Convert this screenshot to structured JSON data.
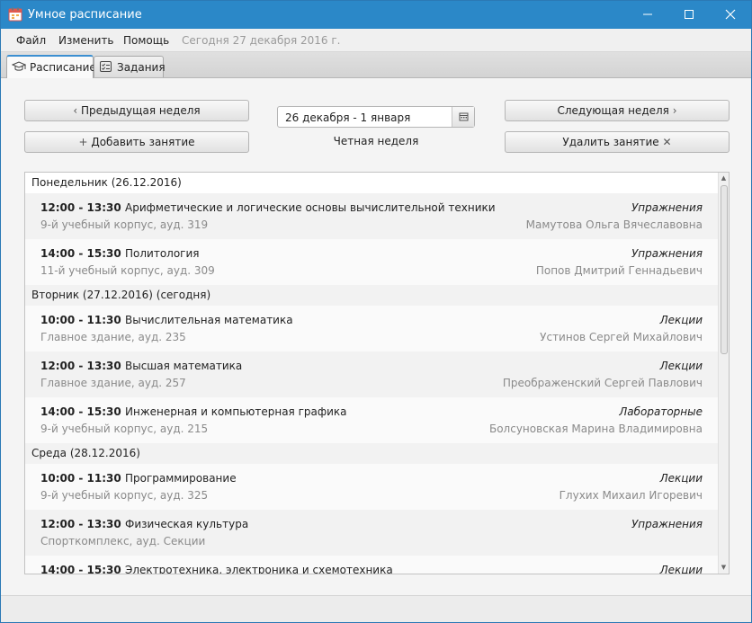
{
  "window": {
    "title": "Умное расписание"
  },
  "menu": {
    "file": "Файл",
    "edit": "Изменить",
    "help": "Помощь",
    "today": "Сегодня 27 декабря 2016 г."
  },
  "tabs": [
    {
      "label": "Расписание",
      "active": true
    },
    {
      "label": "Задания",
      "active": false
    }
  ],
  "toolbar": {
    "prev_week": "Предыдущая неделя",
    "next_week": "Следующая неделя",
    "add_lesson": "Добавить занятие",
    "delete_lesson": "Удалить занятие",
    "date_range": "26 декабря - 1 января",
    "week_parity": "Четная неделя"
  },
  "days": [
    {
      "header": "Понедельник (26.12.2016)",
      "lessons": [
        {
          "time": "12:00 - 13:30",
          "subject": "Арифметические и логические основы вычислительной техники",
          "type": "Упражнения",
          "place": "9-й учебный корпус, ауд. 319",
          "teacher": "Мамутова Ольга Вячеславовна"
        },
        {
          "time": "14:00 - 15:30",
          "subject": "Политология",
          "type": "Упражнения",
          "place": "11-й учебный корпус, ауд. 309",
          "teacher": "Попов Дмитрий Геннадьевич"
        }
      ]
    },
    {
      "header": "Вторник (27.12.2016) (сегодня)",
      "lessons": [
        {
          "time": "10:00 - 11:30",
          "subject": "Вычислительная математика",
          "type": "Лекции",
          "place": "Главное здание, ауд. 235",
          "teacher": "Устинов Сергей Михайлович"
        },
        {
          "time": "12:00 - 13:30",
          "subject": "Высшая математика",
          "type": "Лекции",
          "place": "Главное здание, ауд. 257",
          "teacher": "Преображенский Сергей Павлович"
        },
        {
          "time": "14:00 - 15:30",
          "subject": "Инженерная и компьютерная графика",
          "type": "Лабораторные",
          "place": "9-й учебный корпус, ауд. 215",
          "teacher": "Болсуновская Марина Владимировна"
        }
      ]
    },
    {
      "header": "Среда (28.12.2016)",
      "lessons": [
        {
          "time": "10:00 - 11:30",
          "subject": "Программирование",
          "type": "Лекции",
          "place": "9-й учебный корпус, ауд. 325",
          "teacher": "Глухих Михаил Игоревич"
        },
        {
          "time": "12:00 - 13:30",
          "subject": "Физическая культура",
          "type": "Упражнения",
          "place": "Спорткомплекс, ауд. Секции",
          "teacher": ""
        },
        {
          "time": "14:00 - 15:30",
          "subject": "Электротехника, электроника и схемотехника",
          "type": "Лекции",
          "place": "",
          "teacher": ""
        }
      ]
    }
  ]
}
